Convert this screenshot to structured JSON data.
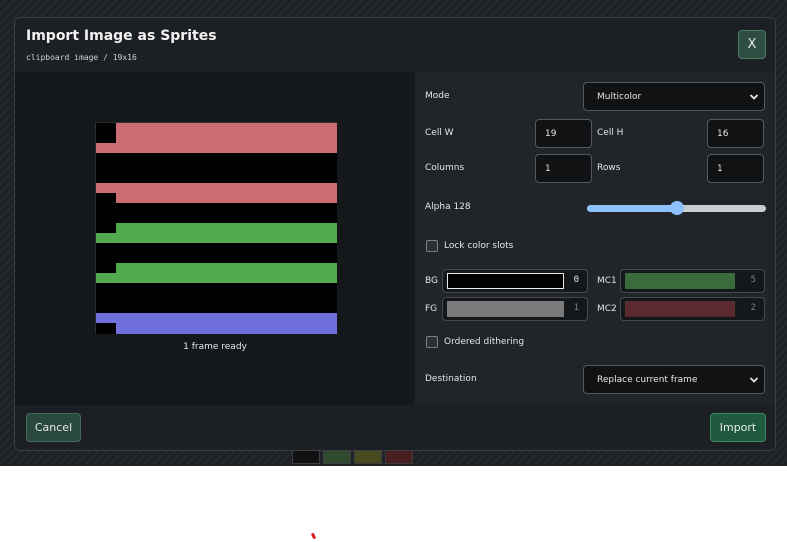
{
  "dialog": {
    "title": "Import Image as Sprites",
    "subtitle": "clipboard image / 19x16",
    "close_label": "X"
  },
  "preview": {
    "status": "1 frame ready",
    "colors": {
      "pink": "#c96d72",
      "green": "#53a94e",
      "blue": "#7070dd",
      "black": "#000000"
    }
  },
  "settings": {
    "mode": {
      "label": "Mode",
      "value": "Multicolor"
    },
    "cell_w": {
      "label": "Cell W",
      "value": "19"
    },
    "cell_h": {
      "label": "Cell H",
      "value": "16"
    },
    "columns": {
      "label": "Columns",
      "value": "1"
    },
    "rows": {
      "label": "Rows",
      "value": "1"
    },
    "alpha": {
      "label": "Alpha 128",
      "value": 128,
      "max": 255
    },
    "lock_color_slots": {
      "label": "Lock color slots",
      "checked": false
    },
    "color_slots": {
      "bg": {
        "label": "BG",
        "index": "0",
        "color": "#000000"
      },
      "fg": {
        "label": "FG",
        "index": "1",
        "color": "#7b7b7b"
      },
      "mc1": {
        "label": "MC1",
        "index": "5",
        "color": "#3a6b3a"
      },
      "mc2": {
        "label": "MC2",
        "index": "2",
        "color": "#5a2a30"
      }
    },
    "ordered_dithering": {
      "label": "Ordered dithering",
      "checked": false
    },
    "destination": {
      "label": "Destination",
      "value": "Replace current frame"
    }
  },
  "footer": {
    "cancel_label": "Cancel",
    "import_label": "Import"
  }
}
